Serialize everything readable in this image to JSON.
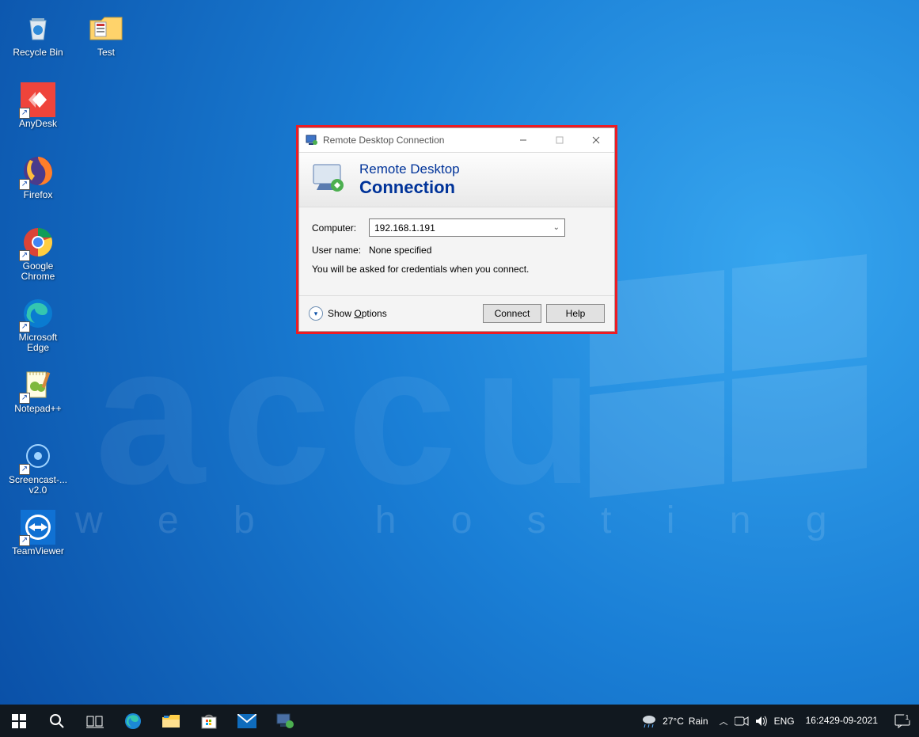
{
  "desktop": {
    "watermark_big": "accu",
    "watermark_line": "w e b   h o s t i n g",
    "icons": [
      {
        "name": "recycle-bin",
        "label": "Recycle Bin",
        "shortcut": false
      },
      {
        "name": "anydesk",
        "label": "AnyDesk",
        "shortcut": true
      },
      {
        "name": "firefox",
        "label": "Firefox",
        "shortcut": true
      },
      {
        "name": "chrome",
        "label": "Google Chrome",
        "shortcut": true
      },
      {
        "name": "edge",
        "label": "Microsoft Edge",
        "shortcut": true
      },
      {
        "name": "notepadpp",
        "label": "Notepad++",
        "shortcut": true
      },
      {
        "name": "screencast",
        "label": "Screencast-... v2.0",
        "shortcut": true
      },
      {
        "name": "teamviewer",
        "label": "TeamViewer",
        "shortcut": true
      }
    ],
    "icon_col2": {
      "name": "test-folder",
      "label": "Test",
      "shortcut": false
    }
  },
  "rdc": {
    "title": "Remote Desktop Connection",
    "banner_line1": "Remote Desktop",
    "banner_line2": "Connection",
    "computer_label": "Computer:",
    "computer_value": "192.168.1.191",
    "username_label": "User name:",
    "username_value": "None specified",
    "hint": "You will be asked for credentials when you connect.",
    "show_options_prefix": "Show ",
    "show_options_hot": "O",
    "show_options_rest": "ptions",
    "connect": "Connect",
    "help": "Help"
  },
  "taskbar": {
    "weather_temp": "27°C",
    "weather_text": "Rain",
    "lang": "ENG",
    "time": "16:24",
    "date": "29-09-2021",
    "notif_count": "1"
  }
}
